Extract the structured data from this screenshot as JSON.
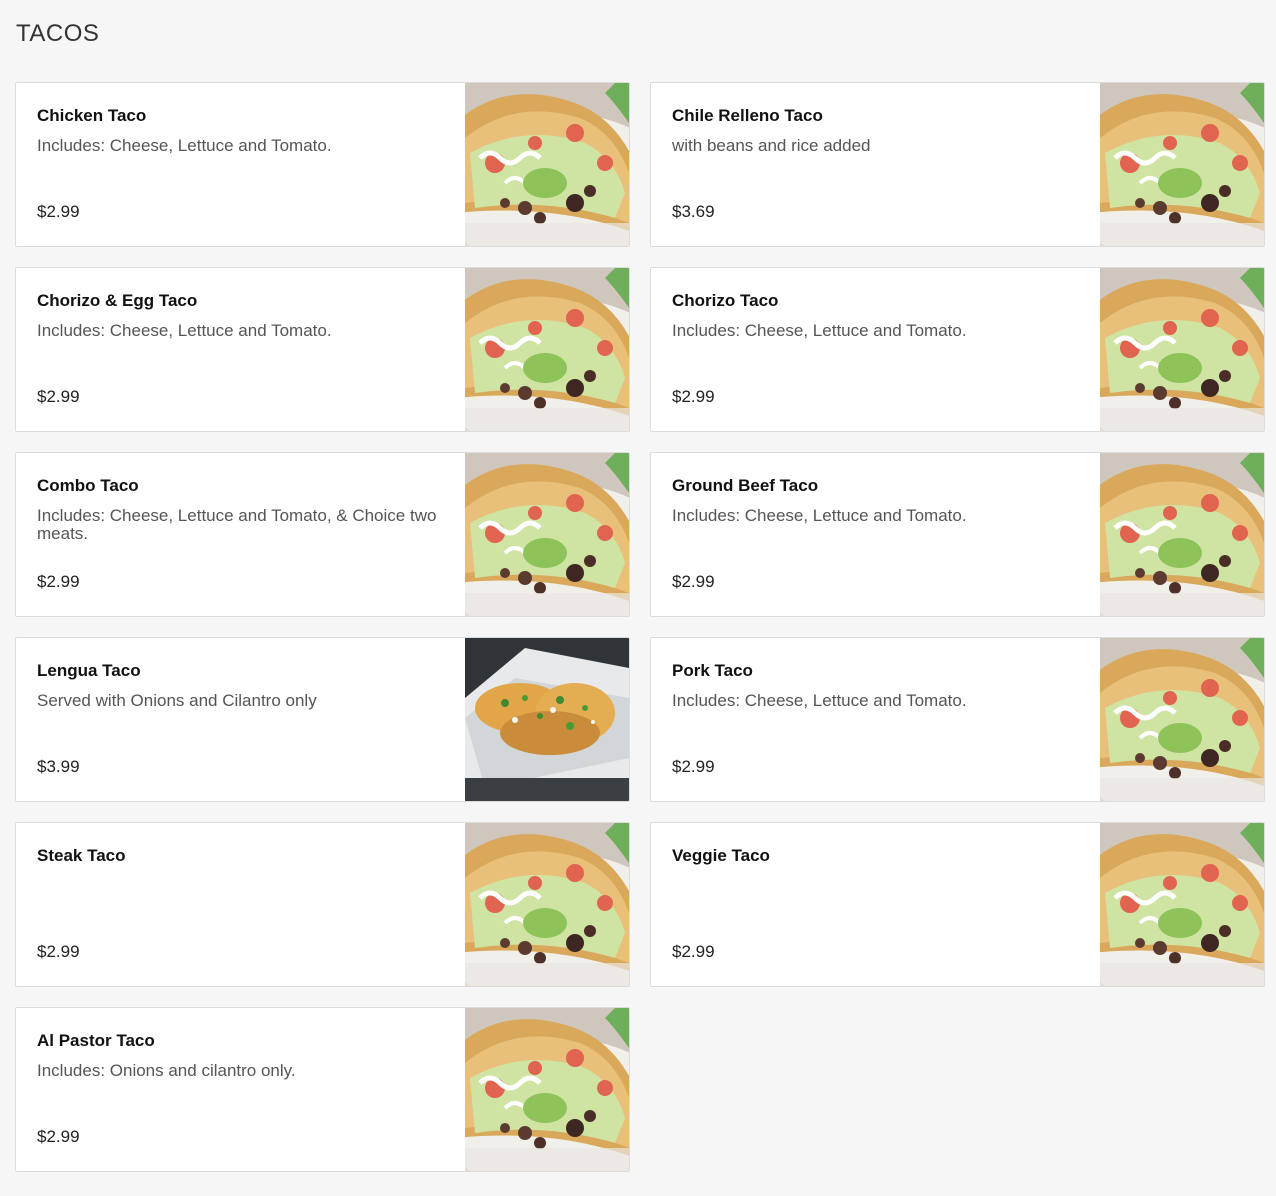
{
  "section": {
    "title": "TACOS"
  },
  "items": [
    {
      "name": "Chicken Taco",
      "description": "Includes: Cheese, Lettuce and Tomato.",
      "price": "$2.99",
      "image": "taco-plate"
    },
    {
      "name": "Chile Relleno Taco",
      "description": "with beans and rice added",
      "price": "$3.69",
      "image": "taco-plate"
    },
    {
      "name": "Chorizo & Egg Taco",
      "description": "Includes: Cheese, Lettuce and Tomato.",
      "price": "$2.99",
      "image": "taco-plate"
    },
    {
      "name": "Chorizo Taco",
      "description": "Includes: Cheese, Lettuce and Tomato.",
      "price": "$2.99",
      "image": "taco-plate"
    },
    {
      "name": "Combo Taco",
      "description": "Includes: Cheese, Lettuce and Tomato, & Choice two meats.",
      "price": "$2.99",
      "image": "taco-plate"
    },
    {
      "name": "Ground Beef Taco",
      "description": "Includes: Cheese, Lettuce and Tomato.",
      "price": "$2.99",
      "image": "taco-plate"
    },
    {
      "name": "Lengua Taco",
      "description": "Served with Onions and Cilantro only",
      "price": "$3.99",
      "image": "lengua-tacos"
    },
    {
      "name": "Pork Taco",
      "description": "Includes: Cheese, Lettuce and Tomato.",
      "price": "$2.99",
      "image": "taco-plate"
    },
    {
      "name": "Steak Taco",
      "description": "",
      "price": "$2.99",
      "image": "taco-plate"
    },
    {
      "name": "Veggie Taco",
      "description": "",
      "price": "$2.99",
      "image": "taco-plate"
    },
    {
      "name": "Al Pastor Taco",
      "description": "Includes: Onions and cilantro only.",
      "price": "$2.99",
      "image": "taco-plate"
    }
  ]
}
